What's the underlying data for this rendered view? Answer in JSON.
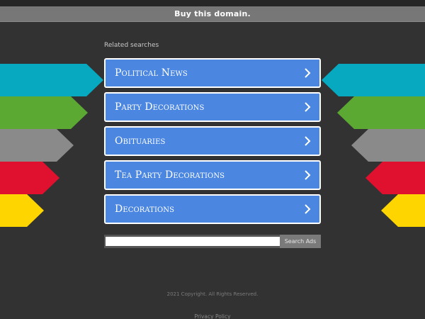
{
  "header": {
    "buy_domain_label": "Buy this domain."
  },
  "related": {
    "title": "Related searches",
    "links": [
      {
        "label": "Political News"
      },
      {
        "label": "Party Decorations"
      },
      {
        "label": "Obituaries"
      },
      {
        "label": "Tea Party Decorations"
      },
      {
        "label": "Decorations"
      }
    ],
    "icon": "chevron-right-icon"
  },
  "search": {
    "input_value": "",
    "button_label": "Search Ads"
  },
  "footer": {
    "copyright": "2021 Copyright. All Rights Reserved.",
    "privacy_label": "Privacy Policy"
  },
  "colors": {
    "background": "#323232",
    "link_blue": "#4b86e0",
    "arrow_cyan": "#06a9bf",
    "arrow_green": "#5ba933",
    "arrow_gray": "#8a8a8a",
    "arrow_red": "#e0102f",
    "arrow_yellow": "#ffd500"
  }
}
